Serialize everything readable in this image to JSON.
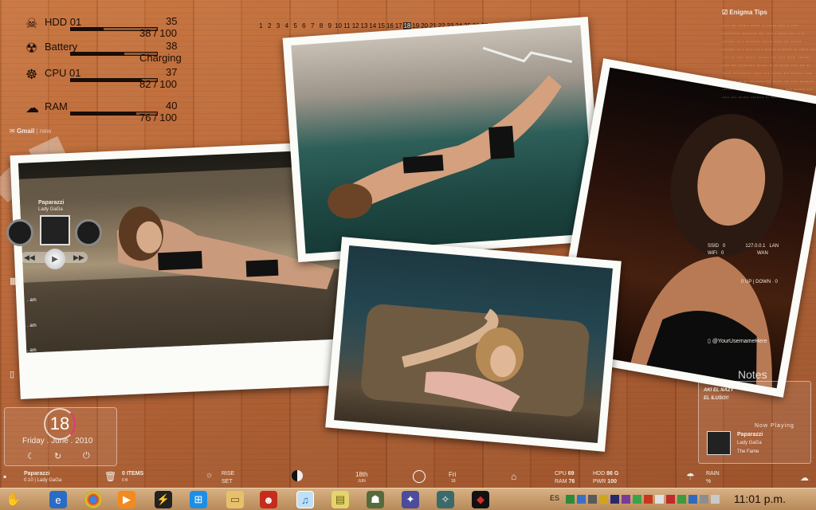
{
  "meters": [
    {
      "name": "HDD 01",
      "top": "35",
      "bottom": "38  / 100",
      "fraction": 0.38,
      "icon": "hdd-icon"
    },
    {
      "name": "Battery",
      "top": "38",
      "bottom": "Charging",
      "fraction": 0.62,
      "icon": "battery-icon"
    },
    {
      "name": "CPU 01",
      "top": "37",
      "bottom": "82  / 100",
      "fraction": 0.82,
      "icon": "cpu-icon"
    },
    {
      "name": "RAM",
      "top": "40",
      "bottom": "76  / 100",
      "fraction": 0.76,
      "icon": "ram-icon"
    }
  ],
  "calendar": {
    "days": [
      "1",
      "2",
      "3",
      "4",
      "5",
      "6",
      "7",
      "8",
      "9",
      "10",
      "11",
      "12",
      "13",
      "14",
      "15",
      "16",
      "17",
      "18",
      "19",
      "20",
      "21",
      "22",
      "23",
      "24",
      "25",
      "26",
      "27",
      "28",
      "29",
      "30"
    ],
    "today": "18"
  },
  "gmail": {
    "label": "Gmail",
    "sep": "|",
    "status": "new"
  },
  "music_left": {
    "title": "Paparazzi",
    "artist": "Lady GaGa"
  },
  "enigma": {
    "title": "Enigma Tips",
    "notes_label": "Notes"
  },
  "network": {
    "ssid": "SSID",
    "wifi": "WiFi",
    "ssid_val": "0",
    "wifi_val": "0",
    "ip": "127.0.0.1",
    "lan": "LAN",
    "wan": "WAN",
    "up_val": "0",
    "up": "UP",
    "down": "DOWN",
    "down_val": "0"
  },
  "twitter": {
    "user": "@YourUsernameHere"
  },
  "note": {
    "line1": "AKI EL NAZY",
    "line2": "EL ILUSO!!"
  },
  "now_playing": {
    "label": "Now Playing",
    "title": "Paparazzi",
    "artist": "Lady GaGa",
    "album": "The Fame"
  },
  "times": {
    "t1": ". am",
    "t2": ". am",
    "t3": ". am"
  },
  "date": {
    "day": "18",
    "text": "Friday . June . 2010"
  },
  "infobar": {
    "track_title": "Paparazzi",
    "track_sub": "0.10 | Lady GaGa",
    "trash_items": "0 ITEMS",
    "trash_size": "0 B",
    "rise": "RISE",
    "set": "SET",
    "date_big": "18th",
    "date_month": "JUN",
    "day_name": "Fri",
    "day_num": "18",
    "cpu_label": "CPU",
    "cpu_val": "69",
    "ram_label": "RAM",
    "ram_val": "76",
    "hdd_label": "HDD",
    "hdd_val": "86 G",
    "pwr_label": "PWR",
    "pwr_val": "100",
    "rain_label": "RAIN",
    "rain_unit": "%"
  },
  "taskbar": {
    "lang": "ES",
    "clock": "11:01 p.m."
  }
}
